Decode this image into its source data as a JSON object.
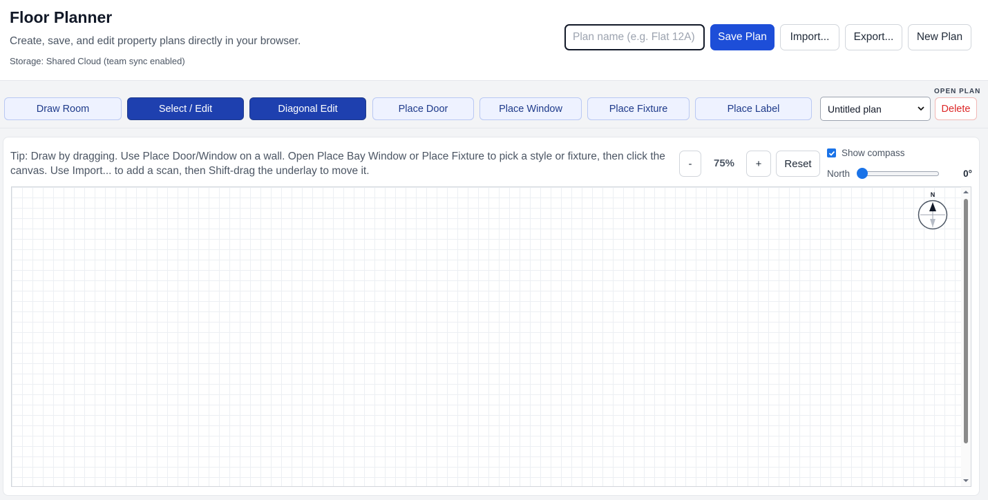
{
  "header": {
    "title": "Floor Planner",
    "subtitle": "Create, save, and edit property plans directly in your browser.",
    "storage": "Storage: Shared Cloud (team sync enabled)",
    "plan_name_placeholder": "Plan name (e.g. Flat 12A)",
    "plan_name_value": "",
    "save_label": "Save Plan",
    "import_label": "Import...",
    "export_label": "Export...",
    "new_label": "New Plan"
  },
  "toolbar": {
    "tools": [
      {
        "label": "Draw Room",
        "active": false
      },
      {
        "label": "Select / Edit",
        "active": true
      },
      {
        "label": "Diagonal Edit",
        "active": true
      },
      {
        "label": "Place Door",
        "active": false
      },
      {
        "label": "Place Window",
        "active": false
      },
      {
        "label": "Place Fixture",
        "active": false
      },
      {
        "label": "Place Label",
        "active": false
      }
    ],
    "open_plan_label": "OPEN PLAN",
    "selected_plan": "Untitled plan",
    "delete_label": "Delete"
  },
  "canvas_panel": {
    "tip": "Tip: Draw by dragging. Use Place Door/Window on a wall. Open Place Bay Window or Place Fixture to pick a style or fixture, then click the canvas. Use Import... to add a scan, then Shift-drag the underlay to move it.",
    "zoom_out_label": "-",
    "zoom_level": "75%",
    "zoom_in_label": "+",
    "reset_label": "Reset",
    "show_compass_label": "Show compass",
    "show_compass_checked": true,
    "north_label": "North",
    "north_value": "0°",
    "north_degrees": 0,
    "compass_letter": "N"
  },
  "colors": {
    "primary": "#1d4ed8",
    "active_tool": "#1e40af",
    "inactive_tool": "#eef2ff",
    "delete": "#dc2626",
    "checkbox": "#1a73e8"
  }
}
